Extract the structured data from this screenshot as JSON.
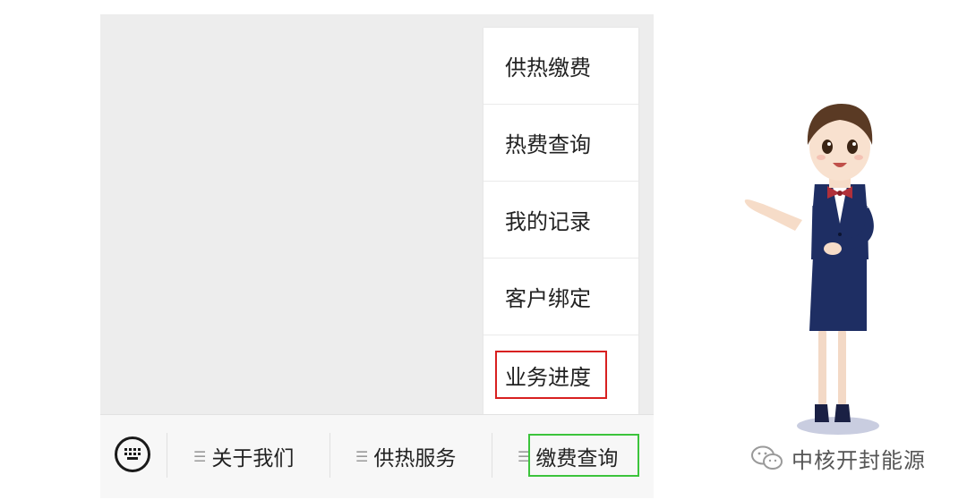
{
  "popup": {
    "items": [
      {
        "label": "供热缴费"
      },
      {
        "label": "热费查询"
      },
      {
        "label": "我的记录"
      },
      {
        "label": "客户绑定"
      },
      {
        "label": "业务进度"
      }
    ]
  },
  "bottom_bar": {
    "keyboard_icon": "keyboard-icon",
    "tabs": [
      {
        "label": "关于我们"
      },
      {
        "label": "供热服务"
      },
      {
        "label": "缴费查询"
      }
    ]
  },
  "brand": {
    "icon": "wechat-icon",
    "name": "中核开封能源"
  },
  "colors": {
    "highlight_red": "#d82020",
    "highlight_green": "#3cc43c",
    "uniform_navy": "#1e2e63"
  }
}
